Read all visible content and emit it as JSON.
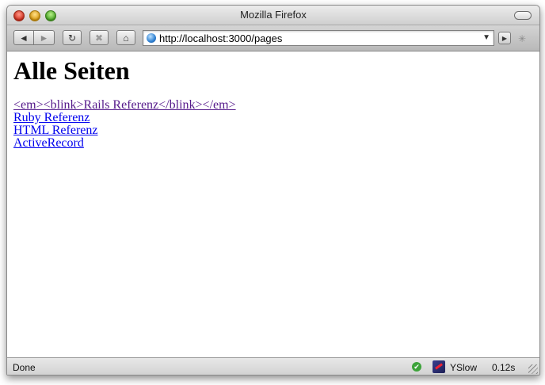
{
  "window": {
    "title": "Mozilla Firefox"
  },
  "toolbar": {
    "back_icon": "◄",
    "forward_icon": "►",
    "reload_icon": "↻",
    "stop_icon": "✖",
    "home_icon": "⌂",
    "url": "http://localhost:3000/pages",
    "dropdown_icon": "▼",
    "go_icon": "▶",
    "spinner_icon": "✳"
  },
  "page": {
    "heading": "Alle Seiten",
    "links": [
      {
        "label": "<em><blink>Rails Referenz</blink></em>",
        "visited": true
      },
      {
        "label": "Ruby Referenz",
        "visited": false
      },
      {
        "label": "HTML Referenz",
        "visited": false
      },
      {
        "label": "ActiveRecord",
        "visited": false
      }
    ]
  },
  "statusbar": {
    "status": "Done",
    "check_icon": "✔",
    "yslow_label": "YSlow",
    "load_time": "0.12s"
  },
  "colors": {
    "link": "#0000ee",
    "visited_link": "#551a8b"
  }
}
